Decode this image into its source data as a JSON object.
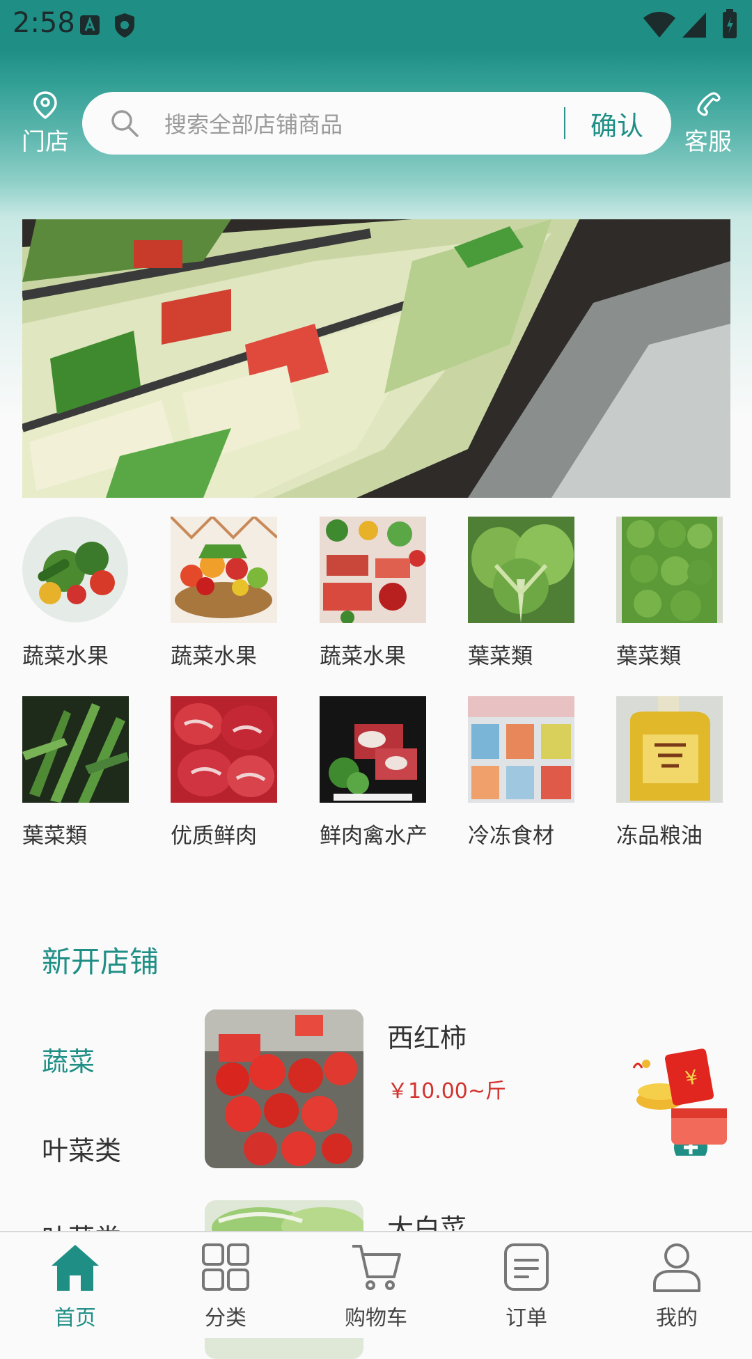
{
  "status_bar": {
    "time": "2:58"
  },
  "header": {
    "store_label": "门店",
    "service_label": "客服",
    "search_placeholder": "搜索全部店铺商品",
    "confirm_label": "确认"
  },
  "categories": [
    {
      "label": "蔬菜水果"
    },
    {
      "label": "蔬菜水果"
    },
    {
      "label": "蔬菜水果"
    },
    {
      "label": "葉菜類"
    },
    {
      "label": "葉菜類"
    },
    {
      "label": "葉菜類"
    },
    {
      "label": "优质鲜肉"
    },
    {
      "label": "鲜肉禽水产"
    },
    {
      "label": "冷冻食材"
    },
    {
      "label": "冻品粮油"
    }
  ],
  "new_stores": {
    "title": "新开店铺",
    "tabs": [
      {
        "label": "蔬菜",
        "active": true
      },
      {
        "label": "叶菜类",
        "active": false
      },
      {
        "label": "叶菜类",
        "active": false
      }
    ],
    "products": [
      {
        "name": "西红柿",
        "price": "￥10.00~斤"
      },
      {
        "name": "大白菜",
        "price": ""
      }
    ]
  },
  "bottom_nav": [
    {
      "label": "首页",
      "icon": "home-icon",
      "active": true
    },
    {
      "label": "分类",
      "icon": "grid-icon",
      "active": false
    },
    {
      "label": "购物车",
      "icon": "cart-icon",
      "active": false
    },
    {
      "label": "订单",
      "icon": "order-icon",
      "active": false
    },
    {
      "label": "我的",
      "icon": "user-icon",
      "active": false
    }
  ],
  "colors": {
    "accent": "#1f8f86",
    "price": "#d2322d"
  }
}
